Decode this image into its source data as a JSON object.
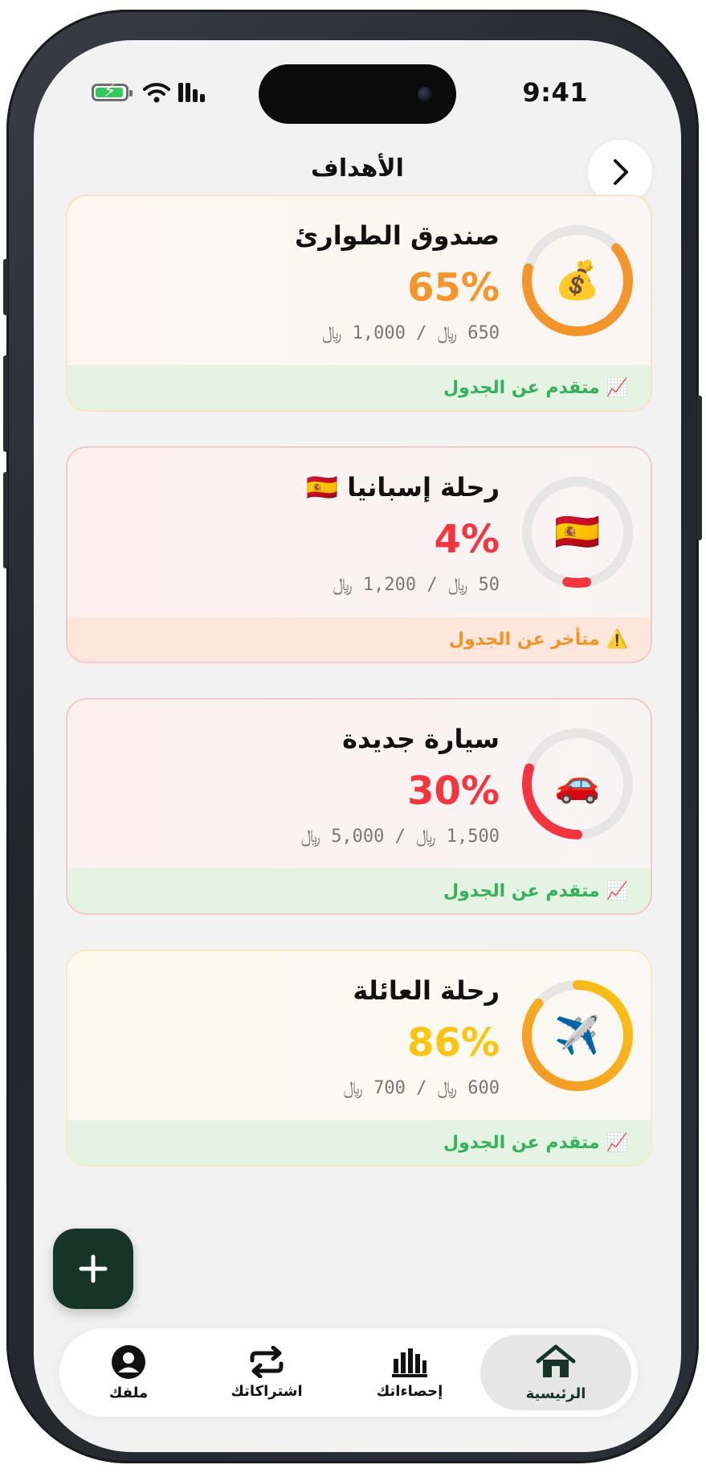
{
  "status_bar": {
    "time": "9:41"
  },
  "header": {
    "title": "الأهداف"
  },
  "goals": [
    {
      "title": "صندوق الطوارئ",
      "emoji": "💰",
      "percent_label": "65%",
      "progress": 0.65,
      "amounts": "650 ﷼ / 1,000 ﷼",
      "status_icon": "📈",
      "status": "متقدم عن الجدول",
      "accent": "#f4952b"
    },
    {
      "title": "رحلة إسبانيا 🇪🇸",
      "emoji": "🇪🇸",
      "percent_label": "4%",
      "progress": 0.04,
      "amounts": "50 ﷼ / 1,200 ﷼",
      "status_icon": "⚠️",
      "status": "متأخر عن الجدول",
      "accent": "#f2353f"
    },
    {
      "title": "سيارة جديدة",
      "emoji": "🚗",
      "percent_label": "30%",
      "progress": 0.3,
      "amounts": "1,500 ﷼ / 5,000 ﷼",
      "status_icon": "📈",
      "status": "متقدم عن الجدول",
      "accent": "#f2353f"
    },
    {
      "title": "رحلة العائلة",
      "emoji": "✈️",
      "percent_label": "86%",
      "progress": 0.86,
      "amounts": "600 ﷼ / 700 ﷼",
      "status_icon": "📈",
      "status": "متقدم عن الجدول",
      "accent": "#fbc413"
    }
  ],
  "tabs": [
    {
      "label": "الرئيسية",
      "icon": "home-icon",
      "active": true
    },
    {
      "label": "إحصاءاتك",
      "icon": "bar-chart-icon",
      "active": false
    },
    {
      "label": "اشتراكاتك",
      "icon": "repeat-icon",
      "active": false
    },
    {
      "label": "ملفك",
      "icon": "user-icon",
      "active": false
    }
  ],
  "colors": {
    "ahead_text": "#34b25a",
    "behind_text": "#f39323",
    "fab": "#163528",
    "ring_track": "#e6e6e6"
  }
}
